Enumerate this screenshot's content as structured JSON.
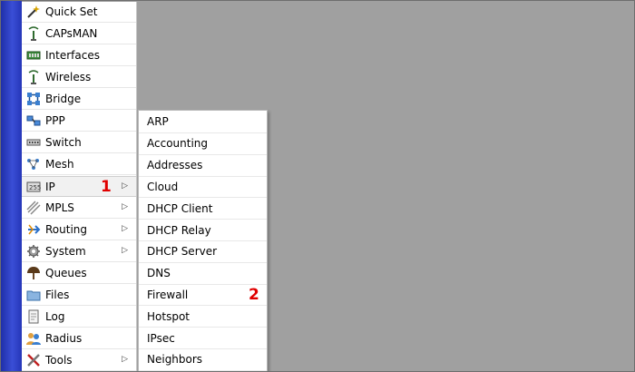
{
  "colors": {
    "background": "#a0a0a0",
    "side_strip": "#3a4ed6",
    "marker": "#e00000"
  },
  "side_menu": {
    "items": [
      {
        "label": "Quick Set",
        "icon": "wand-icon"
      },
      {
        "label": "CAPsMAN",
        "icon": "antenna-icon"
      },
      {
        "label": "Interfaces",
        "icon": "network-card-icon"
      },
      {
        "label": "Wireless",
        "icon": "antenna-icon"
      },
      {
        "label": "Bridge",
        "icon": "bridge-icon"
      },
      {
        "label": "PPP",
        "icon": "ppp-icon"
      },
      {
        "label": "Switch",
        "icon": "switch-icon"
      },
      {
        "label": "Mesh",
        "icon": "mesh-icon"
      },
      {
        "label": "IP",
        "icon": "ip-icon",
        "submenu_arrow": "▷",
        "marker": "1"
      },
      {
        "label": "MPLS",
        "icon": "mpls-icon",
        "submenu_arrow": "▷"
      },
      {
        "label": "Routing",
        "icon": "routing-icon",
        "submenu_arrow": "▷"
      },
      {
        "label": "System",
        "icon": "gear-icon",
        "submenu_arrow": "▷"
      },
      {
        "label": "Queues",
        "icon": "queues-icon"
      },
      {
        "label": "Files",
        "icon": "folder-icon"
      },
      {
        "label": "Log",
        "icon": "log-icon"
      },
      {
        "label": "Radius",
        "icon": "users-icon"
      },
      {
        "label": "Tools",
        "icon": "tools-icon",
        "submenu_arrow": "▷"
      }
    ]
  },
  "submenu": {
    "items": [
      {
        "label": "ARP"
      },
      {
        "label": "Accounting"
      },
      {
        "label": "Addresses"
      },
      {
        "label": "Cloud"
      },
      {
        "label": "DHCP Client"
      },
      {
        "label": "DHCP Relay"
      },
      {
        "label": "DHCP Server"
      },
      {
        "label": "DNS"
      },
      {
        "label": "Firewall",
        "marker": "2"
      },
      {
        "label": "Hotspot"
      },
      {
        "label": "IPsec"
      },
      {
        "label": "Neighbors"
      }
    ]
  }
}
